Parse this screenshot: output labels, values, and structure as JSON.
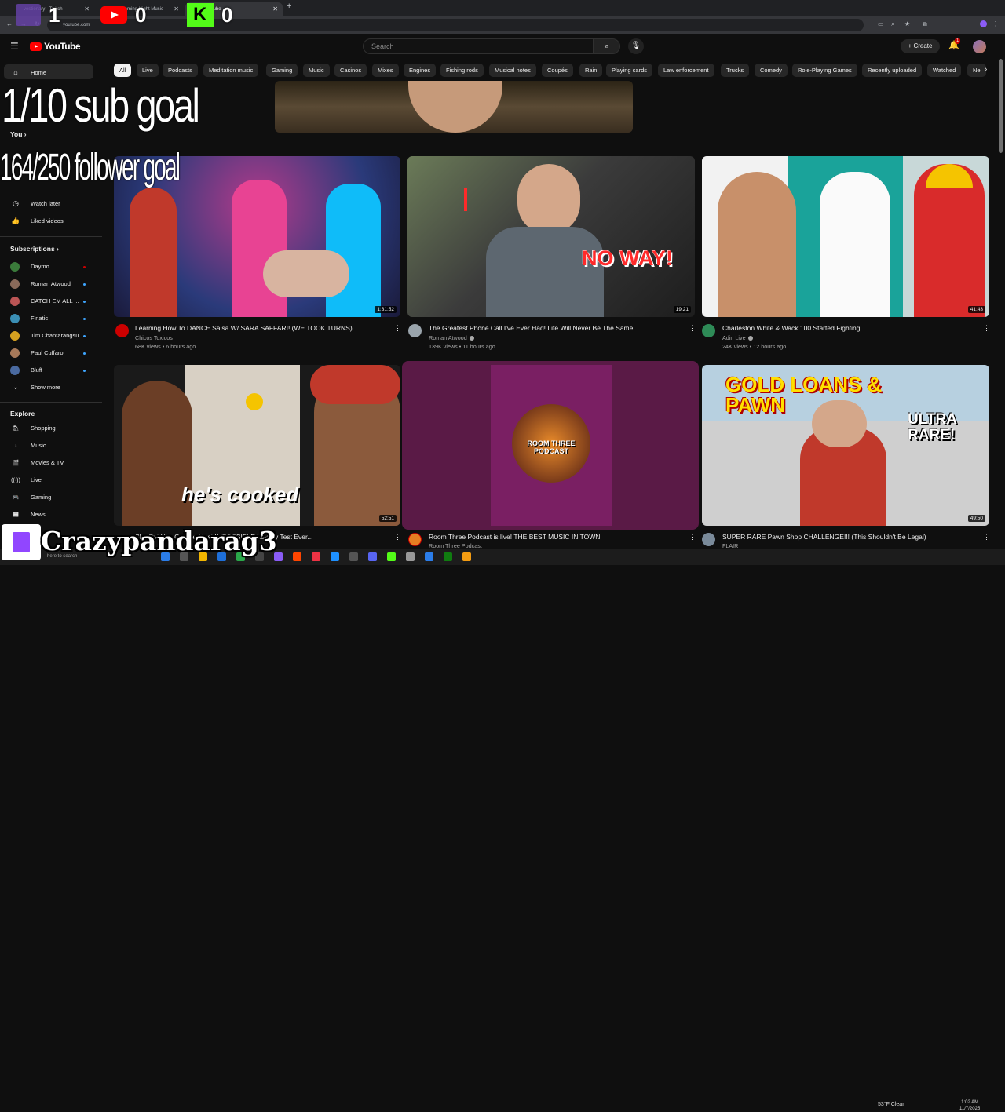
{
  "browser": {
    "tabs": [
      {
        "title": "vestionary - Twitch"
      },
      {
        "title": "Mo Gaming Night Music"
      },
      {
        "title": "YouTube"
      }
    ],
    "address": "youtube.com",
    "overlay_counts": [
      "1",
      "0",
      "0"
    ]
  },
  "header": {
    "logo": "YouTube",
    "search_placeholder": "Search",
    "create_label": "Create",
    "notif_count": "1"
  },
  "chips": [
    "All",
    "Live",
    "Podcasts",
    "Meditation music",
    "Gaming",
    "Music",
    "Casinos",
    "Mixes",
    "Engines",
    "Fishing rods",
    "Musical notes",
    "Coupés",
    "Rain",
    "Playing cards",
    "Law enforcement",
    "Trucks",
    "Comedy",
    "Role-Playing Games",
    "Recently uploaded",
    "Watched",
    "Ne"
  ],
  "sidebar": {
    "home": "Home",
    "you": "You",
    "you_items": [
      "Watch later",
      "Liked videos"
    ],
    "subs_heading": "Subscriptions",
    "subs": [
      "Daymo",
      "Roman Atwood",
      "CATCH EM ALL ...",
      "Finatic",
      "Tim Chantarangsu",
      "Paul Cuffaro",
      "Bluff"
    ],
    "show_more": "Show more",
    "explore_heading": "Explore",
    "explore": [
      "Shopping",
      "Music",
      "Movies & TV",
      "Live",
      "Gaming",
      "News"
    ]
  },
  "videos": [
    {
      "title": "Learning How To DANCE Salsa W/ SARA SAFFARI! (WE TOOK TURNS)",
      "channel": "Chicos Toxicos",
      "meta": "68K views • 6 hours ago",
      "duration": "1:31:52"
    },
    {
      "title": "The Greatest Phone Call I've Ever Had! Life Will Never Be The Same.",
      "channel": "Roman Atwood",
      "meta": "139K views • 11 hours ago",
      "duration": "19:21",
      "thumb_text": "NO WAY!"
    },
    {
      "title": "Charleston White & Wack 100 Started Fighting...",
      "channel": "Adin Live",
      "meta": "24K views • 12 hours ago",
      "duration": "41:43"
    },
    {
      "title": "She Put Him On The Most IMPOSSIBLE Loyalty Test Ever...",
      "channel": "",
      "meta": "",
      "duration": "52:51",
      "thumb_text": "he's cooked"
    },
    {
      "title": "Room Three Podcast is live! THE BEST MUSIC IN TOWN!",
      "channel": "Room Three Podcast",
      "meta": "",
      "duration": "",
      "thumb_text": "ROOM THREE PODCAST"
    },
    {
      "title": "SUPER RARE Pawn Shop CHALLENGE!!! (This Shouldn't Be Legal)",
      "channel": "FLAIR",
      "meta": "",
      "duration": "49:50",
      "thumb_text": "ULTRA RARE!",
      "thumb_text2": "GOLD LOANS & PAWN"
    }
  ],
  "overlay": {
    "sub_goal": "1/10 sub goal",
    "follower_goal": "164/250 follower goal",
    "streamer": "Crazypandarag3"
  },
  "taskbar": {
    "weather": "53°F Clear",
    "time": "1:02 AM",
    "date": "11/7/2025",
    "search": "here to search"
  }
}
